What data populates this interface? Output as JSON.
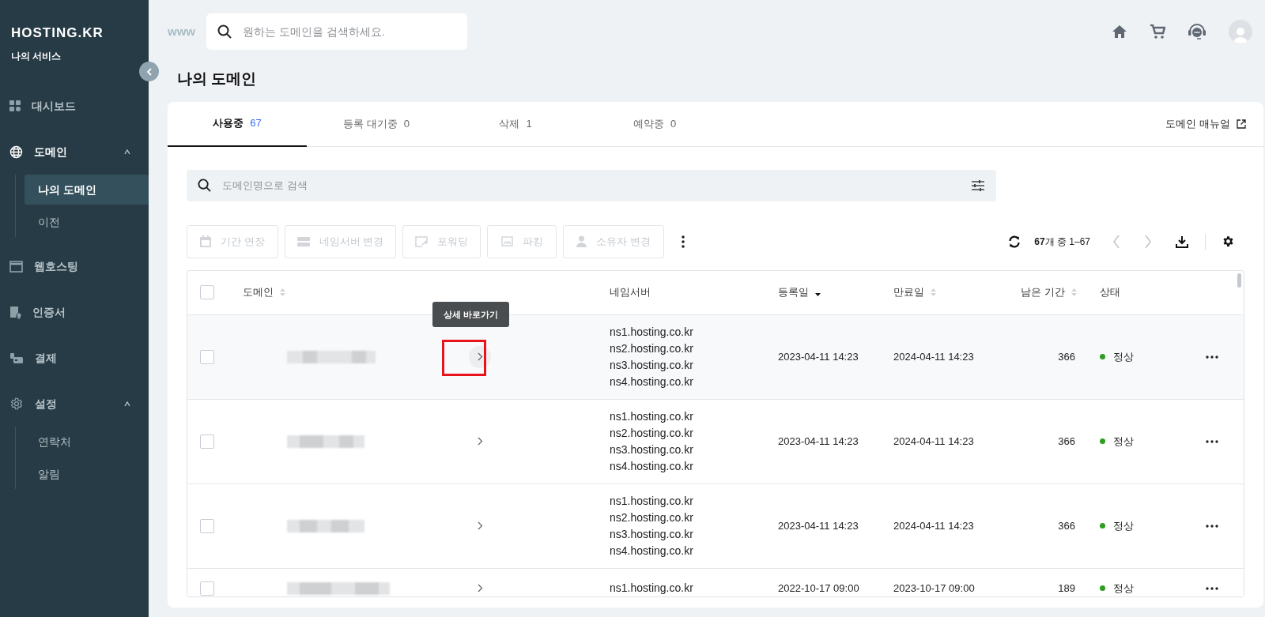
{
  "brand": {
    "logo": "HOSTING.KR",
    "subtitle": "나의 서비스"
  },
  "sidebar": {
    "items": [
      {
        "label": "대시보드",
        "active": false
      },
      {
        "label": "도메인",
        "active": true,
        "expanded": true,
        "children": [
          {
            "label": "나의 도메인",
            "selected": true
          },
          {
            "label": "이전",
            "selected": false
          }
        ]
      },
      {
        "label": "웹호스팅",
        "active": false
      },
      {
        "label": "인증서",
        "active": false
      },
      {
        "label": "결제",
        "active": false
      },
      {
        "label": "설정",
        "active": false,
        "expanded": true,
        "children": [
          {
            "label": "연락처",
            "selected": false
          },
          {
            "label": "알림",
            "selected": false
          }
        ]
      }
    ]
  },
  "topbar": {
    "prefix": "www",
    "search": {
      "placeholder": "원하는 도메인을 검색하세요."
    }
  },
  "page_title": "나의 도메인",
  "tabs": [
    {
      "label": "사용중",
      "count": "67",
      "selected": true
    },
    {
      "label": "등록 대기중",
      "count": "0",
      "selected": false
    },
    {
      "label": "삭제",
      "count": "1",
      "selected": false
    },
    {
      "label": "예약중",
      "count": "0",
      "selected": false
    }
  ],
  "manual_link": "도메인 매뉴얼",
  "domain_search": {
    "placeholder": "도메인명으로 검색"
  },
  "toolbar": [
    {
      "label": "기간 연장",
      "disabled": true
    },
    {
      "label": "네임서버 변경",
      "disabled": true
    },
    {
      "label": "포워딩",
      "disabled": true
    },
    {
      "label": "파킹",
      "disabled": true
    },
    {
      "label": "소유자 변경",
      "disabled": true
    }
  ],
  "pagination": {
    "total": "67",
    "summary": "개 중 1–67"
  },
  "table": {
    "columns": [
      {
        "label": "도메인",
        "sortable": true,
        "sorted_desc": false
      },
      {
        "label": "네임서버",
        "sortable": false
      },
      {
        "label": "등록일",
        "sortable": true,
        "sorted_desc": true
      },
      {
        "label": "만료일",
        "sortable": true,
        "sorted_desc": false
      },
      {
        "label": "남은 기간",
        "sortable": true,
        "sorted_desc": false
      },
      {
        "label": "상태",
        "sortable": false
      }
    ],
    "header_checked": false,
    "tooltip": "상세 바로가기",
    "rows": [
      {
        "checked": false,
        "highlighted": true,
        "nameservers": [
          "ns1.hosting.co.kr",
          "ns2.hosting.co.kr",
          "ns3.hosting.co.kr",
          "ns4.hosting.co.kr"
        ],
        "registered": "2023-04-11 14:23",
        "expires": "2024-04-11 14:23",
        "remaining": "366",
        "status": "정상",
        "color": "#2e9e1f"
      },
      {
        "checked": false,
        "highlighted": false,
        "nameservers": [
          "ns1.hosting.co.kr",
          "ns2.hosting.co.kr",
          "ns3.hosting.co.kr",
          "ns4.hosting.co.kr"
        ],
        "registered": "2023-04-11 14:23",
        "expires": "2024-04-11 14:23",
        "remaining": "366",
        "status": "정상",
        "color": "#2e9e1f"
      },
      {
        "checked": false,
        "highlighted": false,
        "nameservers": [
          "ns1.hosting.co.kr",
          "ns2.hosting.co.kr",
          "ns3.hosting.co.kr",
          "ns4.hosting.co.kr"
        ],
        "registered": "2023-04-11 14:23",
        "expires": "2024-04-11 14:23",
        "remaining": "366",
        "status": "정상",
        "color": "#2e9e1f"
      },
      {
        "checked": false,
        "highlighted": false,
        "nameservers": [
          "ns1.hosting.co.kr"
        ],
        "registered": "2022-10-17 09:00",
        "expires": "2023-10-17 09:00",
        "remaining": "189",
        "status": "정상",
        "color": "#2e9e1f"
      }
    ]
  }
}
